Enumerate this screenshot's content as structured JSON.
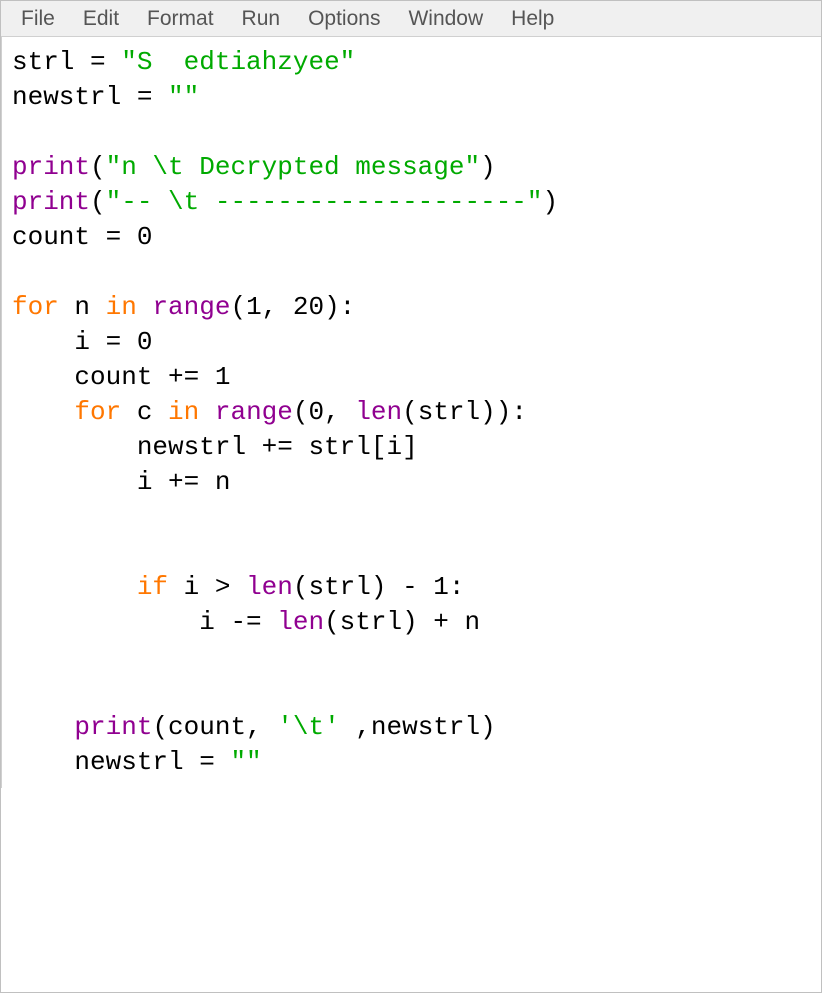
{
  "menubar": {
    "items": [
      {
        "label": "File"
      },
      {
        "label": "Edit"
      },
      {
        "label": "Format"
      },
      {
        "label": "Run"
      },
      {
        "label": "Options"
      },
      {
        "label": "Window"
      },
      {
        "label": "Help"
      }
    ]
  },
  "code": {
    "l1": {
      "var": "strl",
      "eq": " = ",
      "str": "\"S  edtiahzyee\""
    },
    "l2": {
      "var": "newstrl",
      "eq": " = ",
      "str": "\"\""
    },
    "l3": "",
    "l4": {
      "fn": "print",
      "open": "(",
      "str": "\"n \\t Decrypted message\"",
      "close": ")"
    },
    "l5": {
      "fn": "print",
      "open": "(",
      "str": "\"-- \\t --------------------\"",
      "close": ")"
    },
    "l6": {
      "text": "count = 0"
    },
    "l7": "",
    "l8": {
      "kw1": "for",
      "sp1": " n ",
      "kw2": "in",
      "sp2": " ",
      "fn": "range",
      "args": "(1, 20):"
    },
    "l9": {
      "indent": "    ",
      "text": "i = 0"
    },
    "l10": {
      "indent": "    ",
      "text": "count += 1"
    },
    "l11": {
      "indent": "    ",
      "kw1": "for",
      "sp1": " c ",
      "kw2": "in",
      "sp2": " ",
      "fn": "range",
      "open": "(0, ",
      "fn2": "len",
      "args2": "(strl)):"
    },
    "l12": {
      "indent": "        ",
      "text": "newstrl += strl[i]"
    },
    "l13": {
      "indent": "        ",
      "text": "i += n"
    },
    "l14": "",
    "l15": "",
    "l16": {
      "indent": "        ",
      "kw": "if",
      "sp": " i > ",
      "fn": "len",
      "args": "(strl) - 1:"
    },
    "l17": {
      "indent": "            ",
      "pre": "i -= ",
      "fn": "len",
      "args": "(strl) + n"
    },
    "l18": "",
    "l19": "",
    "l20": {
      "indent": "    ",
      "fn": "print",
      "open": "(count, ",
      "str": "'\\t'",
      "close": " ,newstrl)"
    },
    "l21": {
      "indent": "    ",
      "var": "newstrl = ",
      "str": "\"\""
    }
  }
}
